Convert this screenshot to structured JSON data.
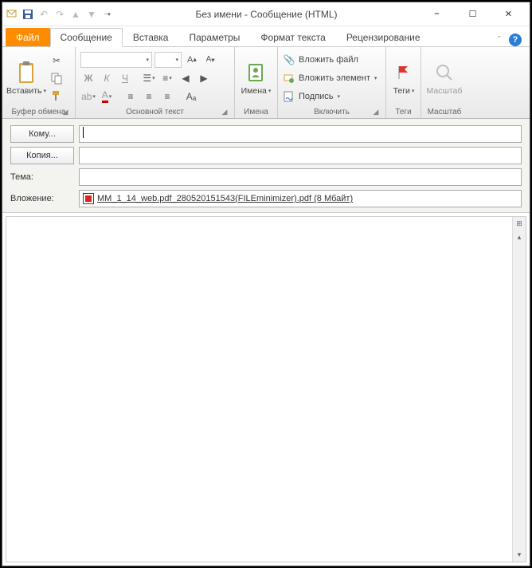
{
  "window": {
    "title": "Без имени  -  Сообщение (HTML)"
  },
  "tabs": {
    "file": "Файл",
    "message": "Сообщение",
    "insert": "Вставка",
    "options": "Параметры",
    "format": "Формат текста",
    "review": "Рецензирование"
  },
  "ribbon": {
    "clipboard": {
      "paste": "Вставить",
      "label": "Буфер обмена"
    },
    "basictext": {
      "label": "Основной текст"
    },
    "names": {
      "names_btn": "Имена",
      "label": "Имена"
    },
    "include": {
      "attach_file": "Вложить файл",
      "attach_item": "Вложить элемент",
      "signature": "Подпись",
      "label": "Включить"
    },
    "tags": {
      "tags_btn": "Теги",
      "label": "Теги"
    },
    "zoom": {
      "zoom_btn": "Масштаб",
      "label": "Масштаб"
    }
  },
  "fields": {
    "to_btn": "Кому...",
    "cc_btn": "Копия...",
    "subject_label": "Тема:",
    "attach_label": "Вложение:",
    "to_value": "",
    "cc_value": "",
    "subject_value": "",
    "attachment": {
      "name": "MM_1_14_web.pdf_280520151543(FILEminimizer).pdf",
      "size": "(8 Мбайт)"
    }
  }
}
